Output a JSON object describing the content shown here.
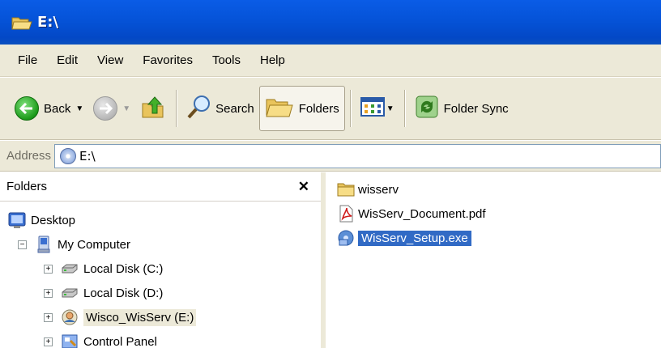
{
  "window": {
    "title": "E:\\"
  },
  "menu": [
    "File",
    "Edit",
    "View",
    "Favorites",
    "Tools",
    "Help"
  ],
  "toolbar": {
    "back_label": "Back",
    "search_label": "Search",
    "folders_label": "Folders",
    "folder_sync_label": "Folder Sync"
  },
  "address": {
    "label": "Address",
    "value": "E:\\"
  },
  "folders_pane": {
    "title": "Folders",
    "tree": [
      {
        "label": "Desktop",
        "icon": "desktop-icon",
        "expander": ""
      },
      {
        "label": "My Computer",
        "icon": "my-computer-icon",
        "expander": "−"
      },
      {
        "label": "Local Disk (C:)",
        "icon": "hard-disk-icon",
        "expander": "+"
      },
      {
        "label": "Local Disk (D:)",
        "icon": "hard-disk-icon",
        "expander": "+"
      },
      {
        "label": "Wisco_WisServ (E:)",
        "icon": "cd-drive-icon",
        "expander": "+"
      },
      {
        "label": "Control Panel",
        "icon": "control-panel-icon",
        "expander": "+"
      }
    ]
  },
  "files": [
    {
      "name": "wisserv",
      "icon": "folder-icon"
    },
    {
      "name": "WisServ_Document.pdf",
      "icon": "pdf-icon"
    },
    {
      "name": "WisServ_Setup.exe",
      "icon": "setup-exe-icon"
    }
  ],
  "colors": {
    "title_bar": "#0553d8",
    "selection": "#316ac5",
    "chrome": "#ece9d8"
  }
}
